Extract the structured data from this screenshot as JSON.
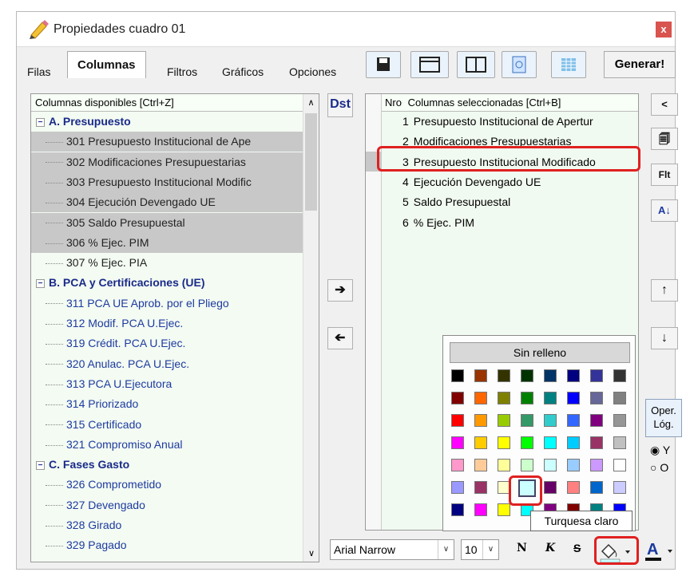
{
  "window": {
    "title": "Propiedades cuadro 01",
    "close": "x"
  },
  "tabs": [
    "Filas",
    "Columnas",
    "Filtros",
    "Gráficos",
    "Opciones"
  ],
  "toolbar": {
    "generar": "Generar!"
  },
  "left": {
    "header": "Columnas disponibles     [Ctrl+Z]",
    "items": [
      {
        "t": "A. Presupuesto",
        "cat": true,
        "exp": "−"
      },
      {
        "t": "301 Presupuesto Institucional de Ape",
        "sel": true
      },
      {
        "t": "302 Modificaciones Presupuestarias",
        "sel": true
      },
      {
        "t": "303 Presupuesto Institucional Modific",
        "sel": true
      },
      {
        "t": "304 Ejecución Devengado UE",
        "sel": true
      },
      {
        "t": "305 Saldo Presupuestal",
        "sel": true
      },
      {
        "t": "306 % Ejec. PIM",
        "sel": true
      },
      {
        "t": "307 % Ejec. PIA"
      },
      {
        "t": "B. PCA y Certificaciones (UE)",
        "cat": true,
        "exp": "−"
      },
      {
        "t": "311 PCA UE Aprob. por el Pliego",
        "blue": true
      },
      {
        "t": "312 Modif. PCA U.Ejec.",
        "blue": true
      },
      {
        "t": "319 Crédit. PCA U.Ejec.",
        "blue": true
      },
      {
        "t": "320 Anulac. PCA U.Ejec.",
        "blue": true
      },
      {
        "t": "313 PCA U.Ejecutora",
        "blue": true
      },
      {
        "t": "314 Priorizado",
        "blue": true
      },
      {
        "t": "315 Certificado",
        "blue": true
      },
      {
        "t": "321 Compromiso Anual",
        "blue": true
      },
      {
        "t": "C. Fases Gasto",
        "cat": true,
        "exp": "−"
      },
      {
        "t": "326 Comprometido",
        "blue": true
      },
      {
        "t": "327 Devengado",
        "blue": true
      },
      {
        "t": "328 Girado",
        "blue": true
      },
      {
        "t": "329 Pagado",
        "blue": true
      }
    ]
  },
  "dst": "Dst",
  "right": {
    "header_nro": "Nro",
    "header_col": "Columnas seleccionadas    [Ctrl+B]",
    "rows": [
      {
        "n": "1",
        "t": "Presupuesto Institucional de Apertur"
      },
      {
        "n": "2",
        "t": "Modificaciones Presupuestarias"
      },
      {
        "n": "3",
        "t": "Presupuesto Institucional Modificado",
        "sel": true
      },
      {
        "n": "4",
        "t": "Ejecución Devengado UE"
      },
      {
        "n": "5",
        "t": "Saldo Presupuestal"
      },
      {
        "n": "6",
        "t": "% Ejec. PIM"
      }
    ]
  },
  "sidebuttons": {
    "flt": "Flt"
  },
  "palette": {
    "no_fill": "Sin relleno",
    "tooltip": "Turquesa claro",
    "rows": [
      [
        "#000000",
        "#993300",
        "#333300",
        "#003300",
        "#003366",
        "#000080",
        "#333399",
        "#333333"
      ],
      [
        "#800000",
        "#ff6600",
        "#808000",
        "#008000",
        "#008080",
        "#0000ff",
        "#666699",
        "#808080"
      ],
      [
        "#ff0000",
        "#ff9900",
        "#99cc00",
        "#339966",
        "#33cccc",
        "#3366ff",
        "#800080",
        "#969696"
      ],
      [
        "#ff00ff",
        "#ffcc00",
        "#ffff00",
        "#00ff00",
        "#00ffff",
        "#00ccff",
        "#993366",
        "#c0c0c0"
      ],
      [
        "#ff99cc",
        "#ffcc99",
        "#ffff99",
        "#ccffcc",
        "#ccffff",
        "#99ccff",
        "#cc99ff",
        "#ffffff"
      ],
      [
        "#9999ff",
        "#993366",
        "#ffffcc",
        "#ccffff",
        "#660066",
        "#ff8080",
        "#0066cc",
        "#ccccff"
      ],
      [
        "#000080",
        "#ff00ff",
        "#ffff00",
        "#00ffff",
        "#800080",
        "#800000",
        "#008080",
        "#0000ff"
      ]
    ]
  },
  "oper": {
    "label": "Oper. Lóg.",
    "y": "Y",
    "o": "O"
  },
  "format": {
    "font": "Arial Narrow",
    "size": "10",
    "bold": "N",
    "italic": "K",
    "strike": "S"
  }
}
